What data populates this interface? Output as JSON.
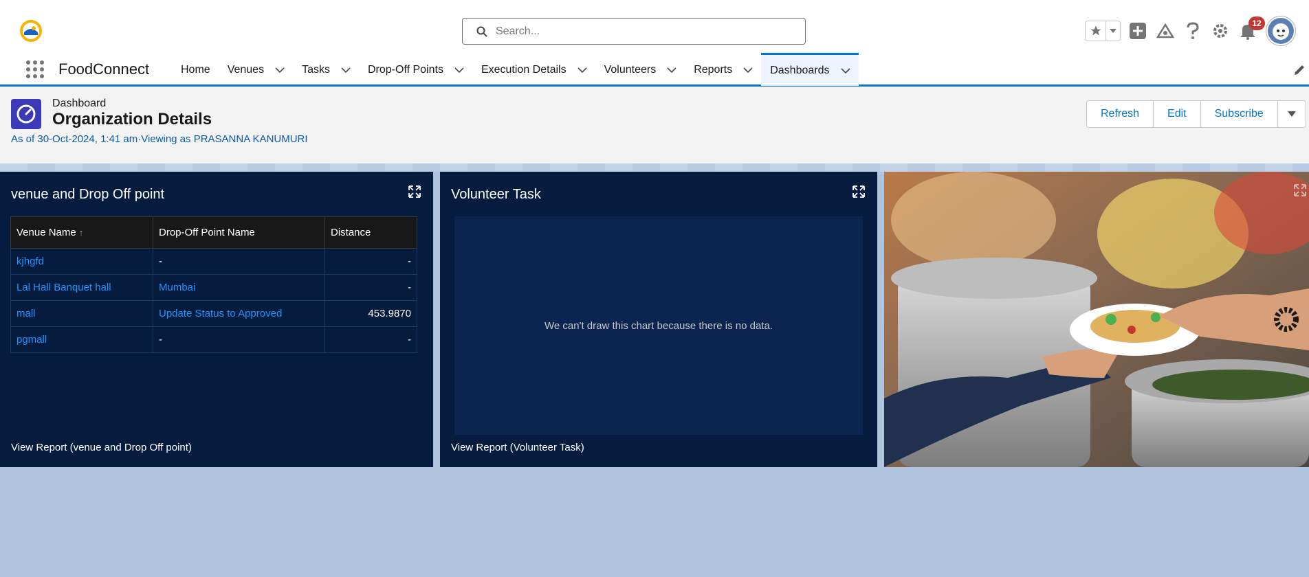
{
  "header": {
    "search_placeholder": "Search...",
    "notification_count": "12"
  },
  "nav": {
    "app_name": "FoodConnect",
    "items": [
      {
        "label": "Home",
        "has_menu": false
      },
      {
        "label": "Venues",
        "has_menu": true
      },
      {
        "label": "Tasks",
        "has_menu": true
      },
      {
        "label": "Drop-Off Points",
        "has_menu": true
      },
      {
        "label": "Execution Details",
        "has_menu": true
      },
      {
        "label": "Volunteers",
        "has_menu": true
      },
      {
        "label": "Reports",
        "has_menu": true
      },
      {
        "label": "Dashboards",
        "has_menu": true,
        "active": true
      }
    ]
  },
  "page": {
    "object_type": "Dashboard",
    "title": "Organization Details",
    "meta": "As of 30-Oct-2024, 1:41 am·Viewing as PRASANNA KANUMURI",
    "buttons": {
      "refresh": "Refresh",
      "edit": "Edit",
      "subscribe": "Subscribe"
    }
  },
  "widgets": {
    "venue": {
      "title": "venue and Drop Off point",
      "columns": [
        "Venue Name",
        "Drop-Off Point Name",
        "Distance"
      ],
      "sort_indicator": "↑",
      "rows": [
        [
          "kjhgfd",
          "-",
          "-"
        ],
        [
          "Lal Hall Banquet hall",
          "Mumbai",
          "-"
        ],
        [
          "mall",
          "Update Status to Approved",
          "453.9870"
        ],
        [
          "pgmall",
          "-",
          "-"
        ]
      ],
      "view_report": "View Report (venue and Drop Off point)"
    },
    "volunteer": {
      "title": "Volunteer Task",
      "empty_message": "We can't draw this chart because there is no data.",
      "view_report": "View Report (Volunteer Task)"
    }
  },
  "colors": {
    "brand": "#0176d3",
    "widget_bg": "#061c3f",
    "canvas_bg": "#b0c4de",
    "link": "#1b96ff"
  }
}
